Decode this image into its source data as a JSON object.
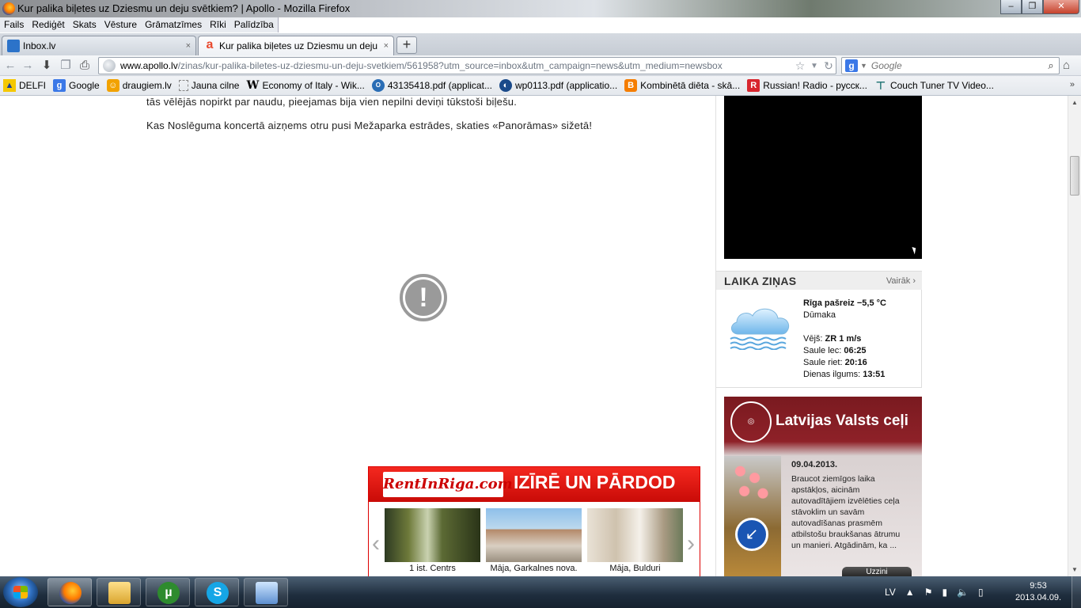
{
  "window": {
    "title": "Kur palika biļetes uz Dziesmu un deju svētkiem? | Apollo - Mozilla Firefox",
    "min": "–",
    "max": "❐",
    "close": "✕"
  },
  "menu": [
    "Fails",
    "Rediģēt",
    "Skats",
    "Vēsture",
    "Grāmatzīmes",
    "Rīki",
    "Palīdzība"
  ],
  "tabs": [
    {
      "label": "Inbox.lv",
      "close": "×"
    },
    {
      "label": "Kur palika biļetes uz Dziesmu un deju ...",
      "close": "×"
    }
  ],
  "newtab": "+",
  "nav": {
    "back": "←",
    "forward": "→",
    "url_domain": "www.apollo.lv",
    "url_path": "/zinas/kur-palika-biletes-uz-dziesmu-un-deju-svetkiem/561958?utm_source=inbox&utm_campaign=news&utm_medium=newsbox",
    "search_placeholder": "Google",
    "search_engine_letter": "g"
  },
  "bookmarks": [
    {
      "label": "DELFI",
      "icon": "delfi-icon",
      "color": "#1c3f94"
    },
    {
      "label": "Google",
      "icon": "google-icon",
      "color": "#3b78e7"
    },
    {
      "label": "draugiem.lv",
      "icon": "draugiem-icon",
      "color": "#f2a200"
    },
    {
      "label": "Jauna cilne",
      "icon": "blank-page-icon",
      "color": "#ffffff"
    },
    {
      "label": "Economy of Italy - Wik...",
      "icon": "wikipedia-icon",
      "color": "#ffffff"
    },
    {
      "label": "43135418.pdf (applicat...",
      "icon": "oecd-icon",
      "color": "#2a6db5"
    },
    {
      "label": "wp0113.pdf (applicatio...",
      "icon": "imf-icon",
      "color": "#1a4a8a"
    },
    {
      "label": "Kombinētā diēta - skā...",
      "icon": "blogger-icon",
      "color": "#f57d00"
    },
    {
      "label": "Russian! Radio - русск...",
      "icon": "radio-icon",
      "color": "#d8262e"
    },
    {
      "label": "Couch Tuner TV Video...",
      "icon": "couchtuner-icon",
      "color": "#2a7a7a"
    }
  ],
  "bookmarks_more": "»",
  "article": {
    "line1": "tās vēlējās nopirkt par naudu, pieejamas bija vien nepilni deviņi tūkstoši biļešu.",
    "line2": "Kas Noslēguma koncertā aizņems otru pusi Mežaparka estrādes, skaties «Panorāmas» sižetā!",
    "plugin_warning": "!"
  },
  "weather": {
    "title": "LAIKA ZIŅAS",
    "more": "Vairāk ›",
    "city": "Rīga pašreiz −5,5 °C",
    "condition": "Dūmaka",
    "wind_label": "Vējš:",
    "wind_value": "ZR 1 m/s",
    "sunrise_label": "Saule lec:",
    "sunrise_value": "06:25",
    "sunset_label": "Saule riet:",
    "sunset_value": "20:16",
    "daylength_label": "Dienas ilgums:",
    "daylength_value": "13:51"
  },
  "lvc_ad": {
    "title": "Latvijas Valsts ceļi",
    "date": "09.04.2013.",
    "text": "Braucot ziemīgos laika apstākļos, aicinām autovadītājiem izvēlēties ceļa stāvoklim un savām autovadīšanas prasmēm atbilstošu braukšanas ātrumu un manieri. Atgādinām, ka ...",
    "button": "Uzzini"
  },
  "rentinriga": {
    "logo": "RentInRiga.com",
    "slogan": "IZĪRĒ UN PĀRDOD",
    "prev": "‹",
    "next": "›",
    "items": [
      {
        "caption": "1 ist. Centrs"
      },
      {
        "caption": "Māja, Garkalnes nova."
      },
      {
        "caption": "Māja, Bulduri"
      }
    ]
  },
  "scrollbar": {
    "up": "▲",
    "down": "▼"
  },
  "taskbar": {
    "language": "LV",
    "time": "9:53",
    "date": "2013.04.09."
  }
}
